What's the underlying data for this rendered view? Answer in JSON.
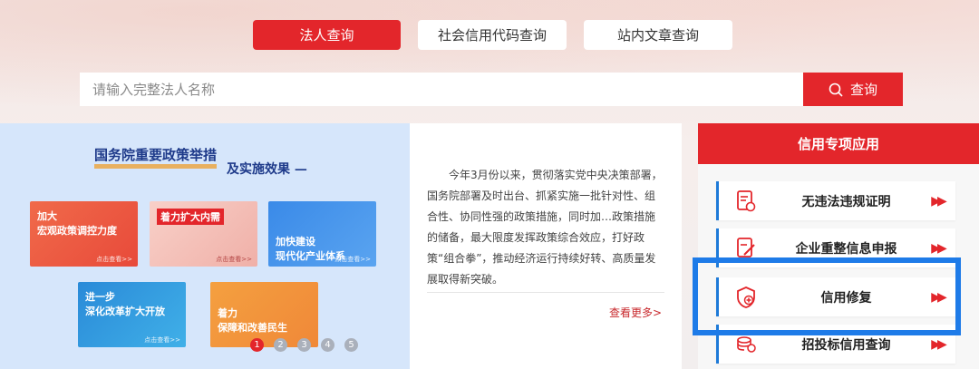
{
  "tabs": [
    {
      "label": "法人查询",
      "active": true
    },
    {
      "label": "社会信用代码查询",
      "active": false
    },
    {
      "label": "站内文章查询",
      "active": false
    }
  ],
  "search": {
    "placeholder": "请输入完整法人名称",
    "button_label": "查询",
    "icon": "search-icon"
  },
  "banner": {
    "title": "国务院重要政策举措",
    "subtitle": "及实施效果 —",
    "cards": [
      {
        "label": "加大\n宏观政策调控力度",
        "more": "点击查看>>"
      },
      {
        "label": "着力扩大内需",
        "more": "点击查看>>"
      },
      {
        "label": "加快建设\n现代化产业体系",
        "more": "点击查看>>"
      },
      {
        "label": "进一步\n深化改革扩大开放",
        "more": "点击查看>>"
      },
      {
        "label": "着力\n保障和改善民生",
        "more": ""
      }
    ],
    "dots": [
      "1",
      "2",
      "3",
      "4",
      "5"
    ],
    "active_dot": 1
  },
  "article": {
    "text": "今年3月份以来，贯彻落实党中央决策部署，国务院部署及时出台、抓紧实施一批针对性、组合性、协同性强的政策措施，同时加…政策措施的储备，最大限度发挥政策综合效应，打好政策“组合拳”，推动经济运行持续好转、高质量发展取得新突破。",
    "more_label": "查看更多>"
  },
  "credit_panel": {
    "title": "信用专项应用",
    "items": [
      {
        "label": "无违法违规证明",
        "icon": "document-check-icon"
      },
      {
        "label": "企业重整信息申报",
        "icon": "edit-document-icon"
      },
      {
        "label": "信用修复",
        "icon": "shield-plus-icon"
      },
      {
        "label": "招投标信用查询",
        "icon": "coins-icon"
      }
    ],
    "arrow_icon": "double-arrow-right-icon"
  },
  "colors": {
    "brand_red": "#e3262b",
    "highlight_blue": "#1e7be8"
  }
}
